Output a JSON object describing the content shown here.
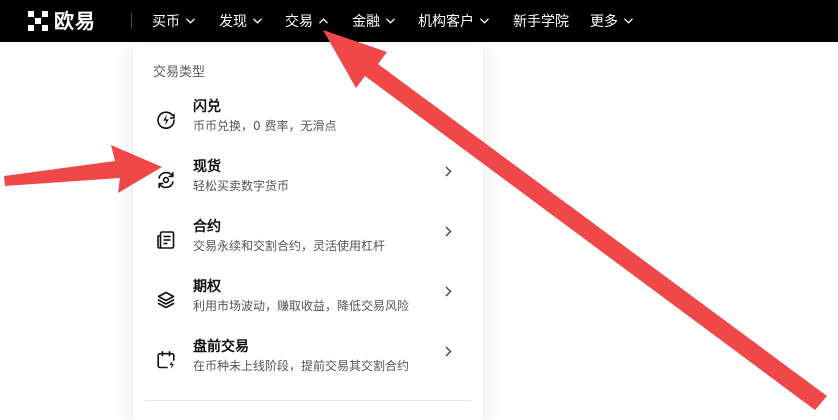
{
  "header": {
    "logo_text": "欧易",
    "nav": [
      {
        "label": "买币",
        "has_chevron": true,
        "expanded": false
      },
      {
        "label": "发现",
        "has_chevron": true,
        "expanded": false
      },
      {
        "label": "交易",
        "has_chevron": true,
        "expanded": true
      },
      {
        "label": "金融",
        "has_chevron": true,
        "expanded": false
      },
      {
        "label": "机构客户",
        "has_chevron": true,
        "expanded": false
      },
      {
        "label": "新手学院",
        "has_chevron": false,
        "expanded": false
      },
      {
        "label": "更多",
        "has_chevron": true,
        "expanded": false
      }
    ]
  },
  "dropdown": {
    "heading": "交易类型",
    "items": [
      {
        "title": "闪兑",
        "desc": "币币兑换，0 费率，无滑点",
        "icon": "lightning-circle-icon",
        "has_arrow": false
      },
      {
        "title": "现货",
        "desc": "轻松买卖数字货币",
        "icon": "spot-exchange-icon",
        "has_arrow": true
      },
      {
        "title": "合约",
        "desc": "交易永续和交割合约，灵活使用杠杆",
        "icon": "contract-document-icon",
        "has_arrow": true
      },
      {
        "title": "期权",
        "desc": "利用市场波动，赚取收益，降低交易风险",
        "icon": "layers-icon",
        "has_arrow": true
      },
      {
        "title": "盘前交易",
        "desc": "在币种未上线阶段，提前交易其交割合约",
        "icon": "calendar-bolt-icon",
        "has_arrow": true
      }
    ]
  },
  "colors": {
    "topbar_bg": "#000000",
    "nav_text": "#ffffff",
    "annotation_arrow": "#f04848"
  }
}
